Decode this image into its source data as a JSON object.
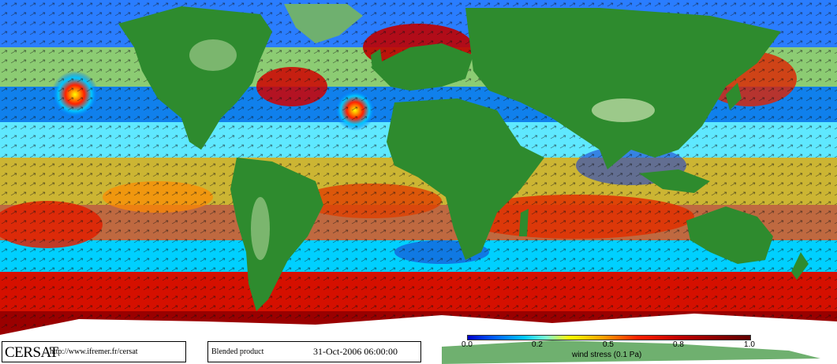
{
  "map": {
    "colors": {
      "ocean_low": "#0000c8",
      "ocean_mid": "#00c8ff",
      "ocean_yellow": "#ffff00",
      "ocean_high": "#ff2000",
      "ocean_max": "#8b0000",
      "land_green": "#2e8b2e",
      "land_light": "#9cc98a",
      "ice": "#ffffff"
    }
  },
  "footer": {
    "logo": "CERSAT",
    "url": "http://www.ifremer.fr/cersat",
    "product": "Blended product",
    "datetime": "31-Oct-2006 06:00:00"
  },
  "colorbar": {
    "ticks": [
      "0.0",
      "0.2",
      "0.5",
      "0.8",
      "1.0"
    ],
    "tick_values": [
      0.0,
      0.2,
      0.5,
      0.8,
      1.0
    ],
    "range": [
      0.0,
      1.0
    ],
    "title": "wind stress (0.1 Pa)"
  }
}
